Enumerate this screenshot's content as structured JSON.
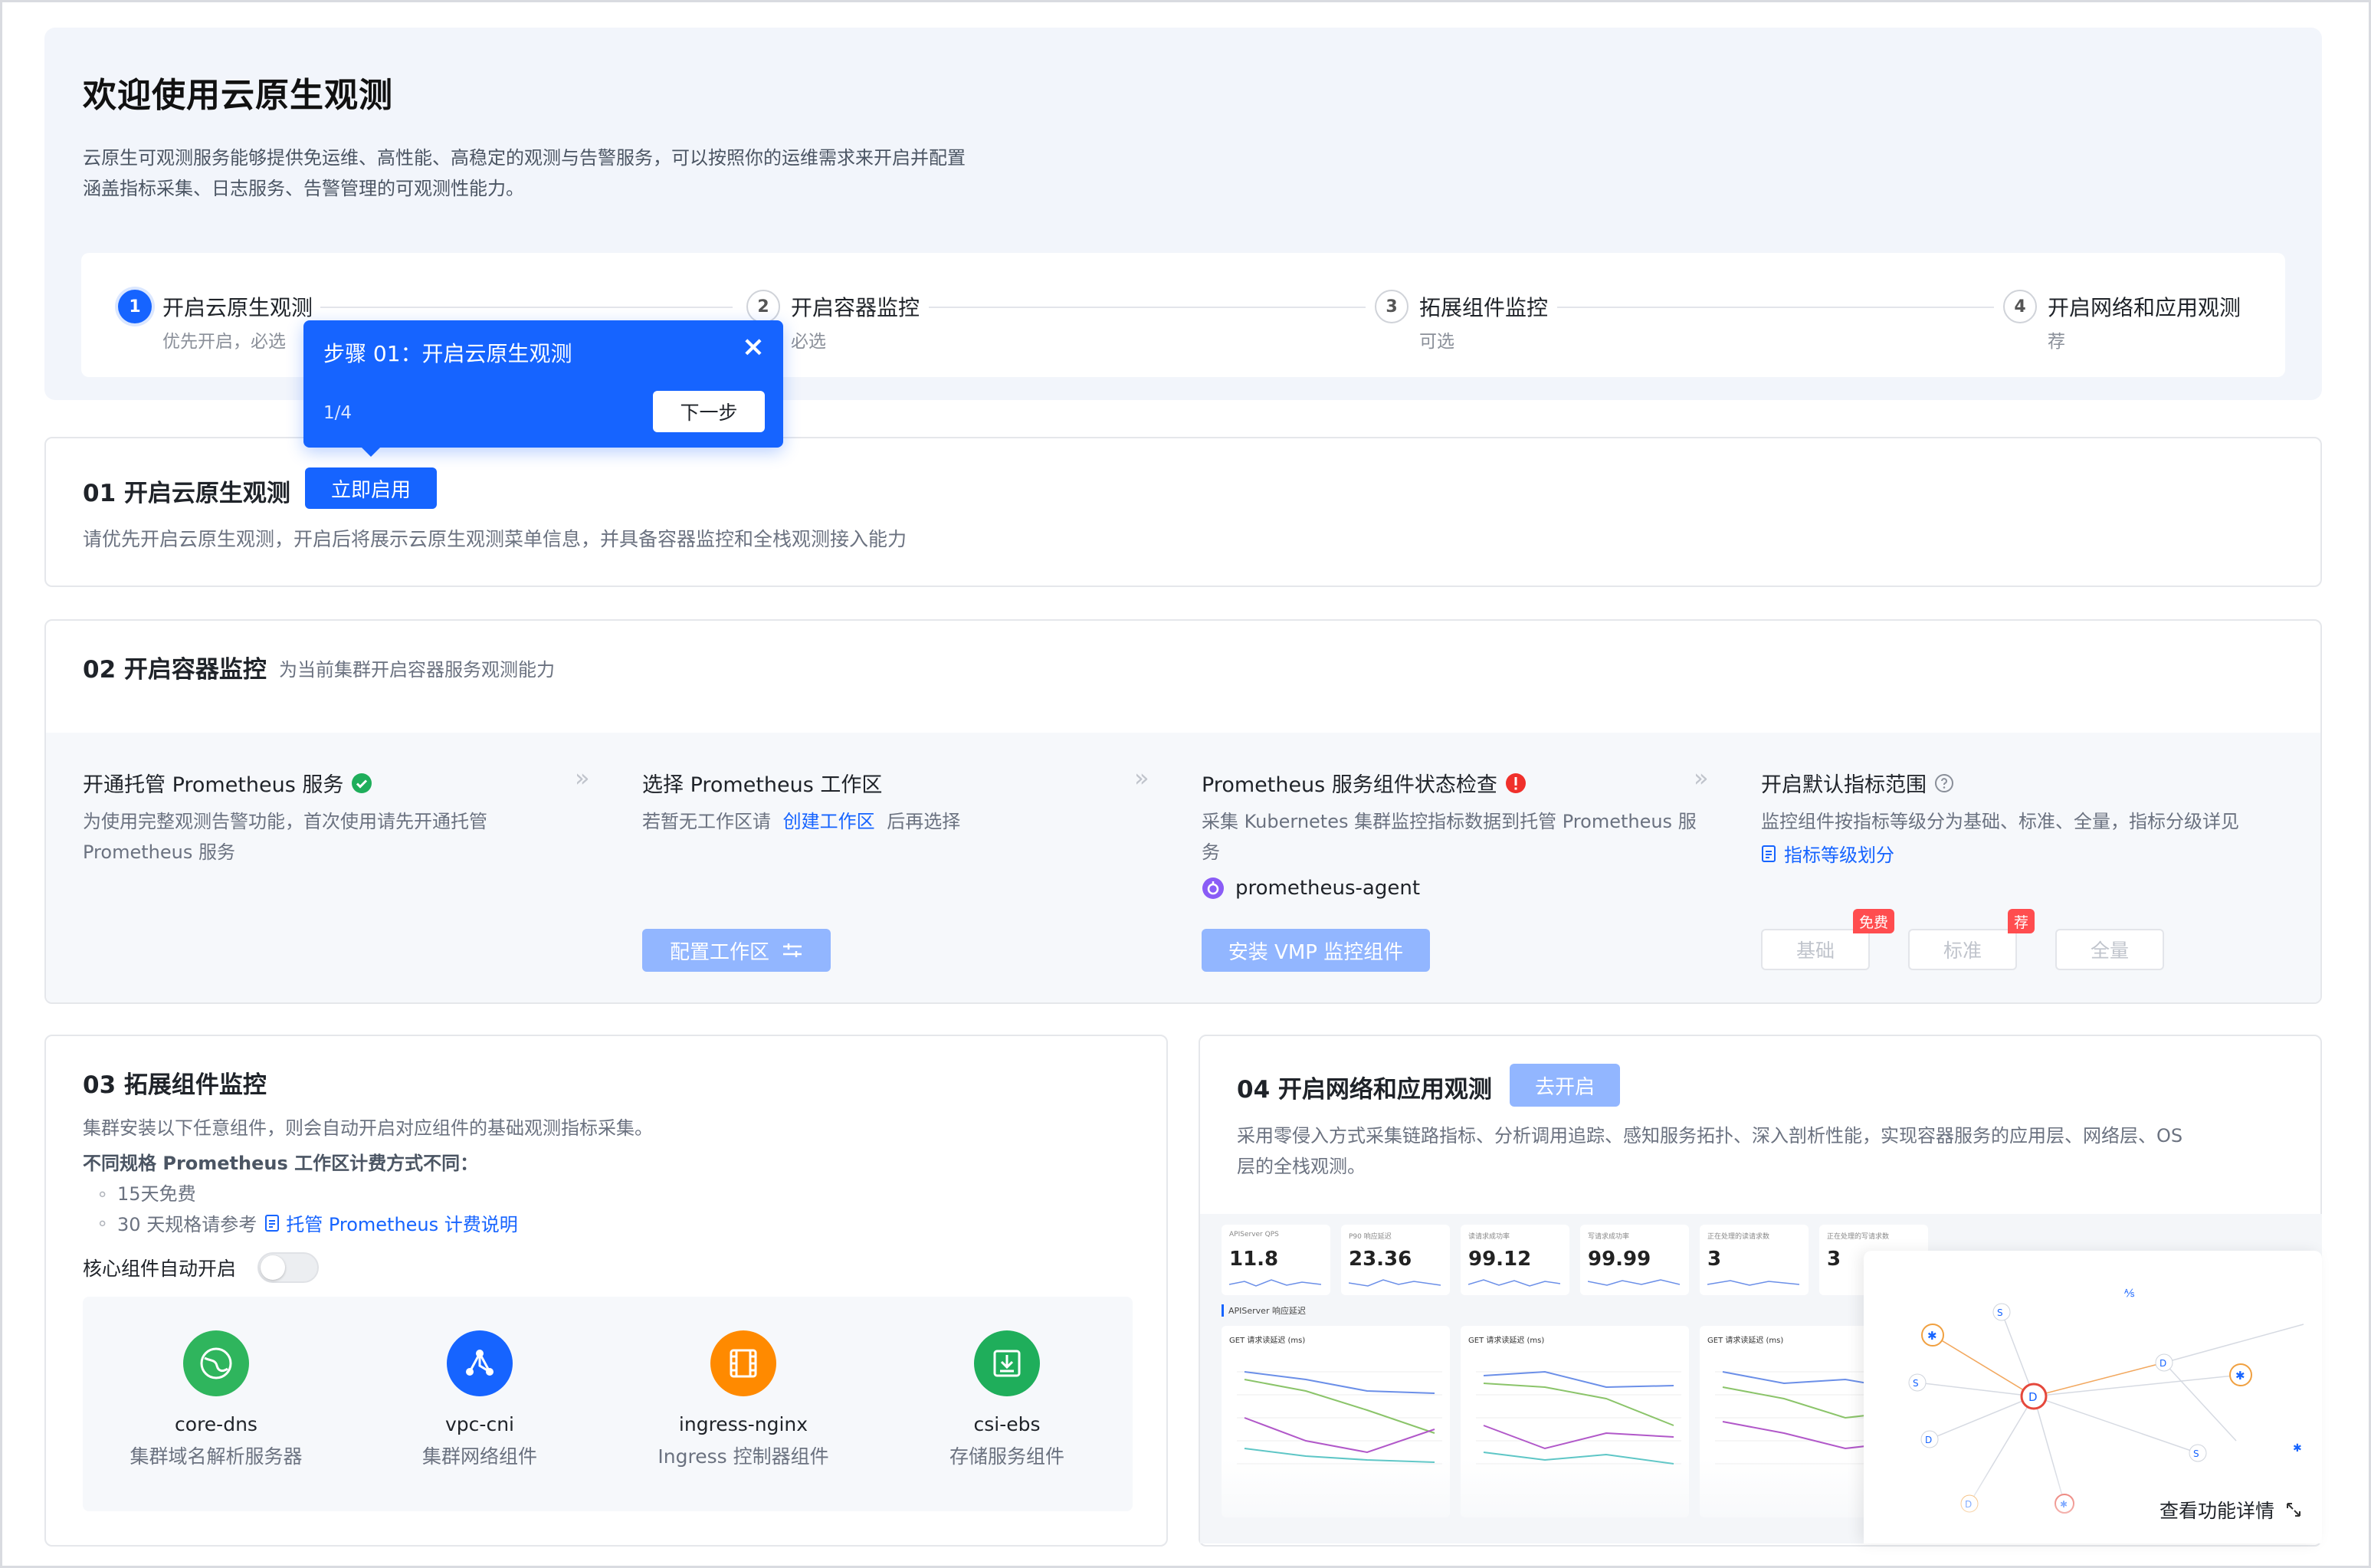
{
  "hero": {
    "title": "欢迎使用云原生观测",
    "desc_line1": "云原生可观测服务能够提供免运维、高性能、高稳定的观测与告警服务，可以按照你的运维需求来开启并配置",
    "desc_line2": "涵盖指标采集、日志服务、告警管理的可观测性能力。"
  },
  "steps": [
    {
      "num": "1",
      "title": "开启云原生观测",
      "sub": "优先开启，必选"
    },
    {
      "num": "2",
      "title": "开启容器监控",
      "sub": "必选"
    },
    {
      "num": "3",
      "title": "拓展组件监控",
      "sub": "可选"
    },
    {
      "num": "4",
      "title": "开启网络和应用观测",
      "sub": "荐"
    }
  ],
  "popover": {
    "title": "步骤 01：开启云原生观测",
    "progress": "1/4",
    "next_label": "下一步",
    "close_icon": "×"
  },
  "sec1": {
    "title": "01 开启云原生观测",
    "button": "立即启用",
    "desc": "请优先开启云原生观测，开启后将展示云原生观测菜单信息，并具备容器监控和全栈观测接入能力"
  },
  "sec2": {
    "title": "02 开启容器监控",
    "subtitle": "为当前集群开启容器服务观测能力",
    "col1": {
      "title": "开通托管 Prometheus 服务",
      "desc_line1": "为使用完整观测告警功能，首次使用请先开通托管",
      "desc_line2": "Prometheus 服务"
    },
    "col2": {
      "title": "选择 Prometheus 工作区",
      "desc_before": "若暂无工作区请",
      "link": "创建工作区",
      "desc_after": "后再选择",
      "button": "配置工作区"
    },
    "col3": {
      "title": "Prometheus 服务组件状态检查",
      "desc_line1": "采集 Kubernetes 集群监控指标数据到托管 Prometheus 服",
      "desc_line2": "务",
      "agent": "prometheus-agent",
      "button": "安装 VMP 监控组件"
    },
    "col4": {
      "title": "开启默认指标范围",
      "desc": "监控组件按指标等级分为基础、标准、全量，指标分级详见",
      "link": "指标等级划分",
      "levels": [
        "基础",
        "标准",
        "全量"
      ],
      "tag_free": "免费",
      "tag_rec": "荐"
    }
  },
  "sec3": {
    "title": "03 拓展组件监控",
    "desc": "集群安装以下任意组件，则会自动开启对应组件的基础观测指标采集。",
    "note": "不同规格 Prometheus 工作区计费方式不同：",
    "bullet1": "15天免费",
    "bullet2_before": "30 天规格请参考",
    "bullet2_link": "托管 Prometheus 计费说明",
    "toggle_label": "核心组件自动开启",
    "plugins": [
      {
        "name": "core-dns",
        "desc": "集群域名解析服务器",
        "color": "#2fb55d"
      },
      {
        "name": "vpc-cni",
        "desc": "集群网络组件",
        "color": "#1664ff"
      },
      {
        "name": "ingress-nginx",
        "desc": "Ingress 控制器组件",
        "color": "#ff8a00"
      },
      {
        "name": "csi-ebs",
        "desc": "存储服务组件",
        "color": "#1fae5b"
      }
    ]
  },
  "sec4": {
    "title": "04 开启网络和应用观测",
    "button": "去开启",
    "desc_line1": "采用零侵入方式采集链路指标、分析调用追踪、感知服务拓扑、深入剖析性能，实现容器服务的应用层、网络层、OS",
    "desc_line2": "层的全栈观测。",
    "details_link": "查看功能详情",
    "kpis": [
      {
        "label": "APIServer QPS",
        "value": "11.8"
      },
      {
        "label": "P90 响应延迟",
        "value": "23.36"
      },
      {
        "label": "读请求成功率",
        "value": "99.12"
      },
      {
        "label": "写请求成功率",
        "value": "99.99"
      },
      {
        "label": "正在处理的读请求数",
        "value": "3"
      },
      {
        "label": "正在处理的写请求数",
        "value": "3"
      }
    ],
    "section_label": "APIServer 响应延迟",
    "panel_title": "GET 请求读延迟 (ms)"
  }
}
